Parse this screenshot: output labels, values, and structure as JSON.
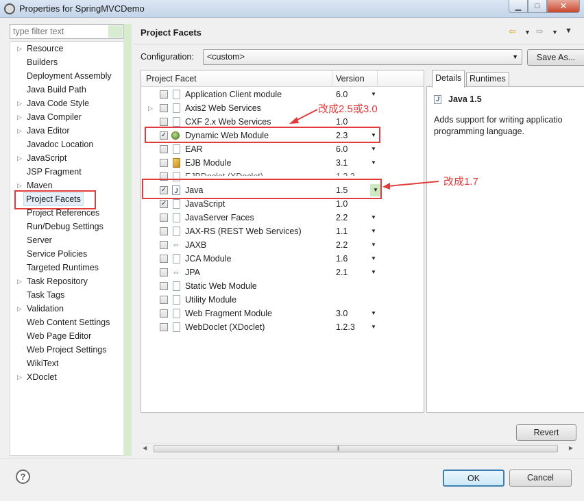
{
  "window": {
    "title": "Properties for SpringMVCDemo",
    "minimize_glyph": "▁",
    "maximize_glyph": "□",
    "close_glyph": "✕",
    "app_icon": "settings-icon"
  },
  "filter": {
    "placeholder": "type filter text",
    "value": ""
  },
  "nav": {
    "items": [
      {
        "label": "Resource",
        "expandable": true
      },
      {
        "label": "Builders",
        "expandable": false
      },
      {
        "label": "Deployment Assembly",
        "expandable": false
      },
      {
        "label": "Java Build Path",
        "expandable": false
      },
      {
        "label": "Java Code Style",
        "expandable": true
      },
      {
        "label": "Java Compiler",
        "expandable": true
      },
      {
        "label": "Java Editor",
        "expandable": true
      },
      {
        "label": "Javadoc Location",
        "expandable": false
      },
      {
        "label": "JavaScript",
        "expandable": true
      },
      {
        "label": "JSP Fragment",
        "expandable": false
      },
      {
        "label": "Maven",
        "expandable": true
      },
      {
        "label": "Project Facets",
        "expandable": false,
        "selected": true
      },
      {
        "label": "Project References",
        "expandable": false
      },
      {
        "label": "Run/Debug Settings",
        "expandable": false
      },
      {
        "label": "Server",
        "expandable": false
      },
      {
        "label": "Service Policies",
        "expandable": false
      },
      {
        "label": "Targeted Runtimes",
        "expandable": false
      },
      {
        "label": "Task Repository",
        "expandable": true
      },
      {
        "label": "Task Tags",
        "expandable": false
      },
      {
        "label": "Validation",
        "expandable": true
      },
      {
        "label": "Web Content Settings",
        "expandable": false
      },
      {
        "label": "Web Page Editor",
        "expandable": false
      },
      {
        "label": "Web Project Settings",
        "expandable": false
      },
      {
        "label": "WikiText",
        "expandable": false
      },
      {
        "label": "XDoclet",
        "expandable": true
      }
    ]
  },
  "page": {
    "title": "Project Facets"
  },
  "configuration": {
    "label": "Configuration:",
    "value": "<custom>",
    "save_as": "Save As..."
  },
  "facets": {
    "col_facet": "Project Facet",
    "col_version": "Version",
    "rows": [
      {
        "name": "Application Client module",
        "version": "6.0",
        "checked": false,
        "icon": "page-icon",
        "dropdown": true
      },
      {
        "name": "Axis2 Web Services",
        "version": "",
        "checked": false,
        "icon": "page-icon",
        "expandable": true,
        "dropdown": false
      },
      {
        "name": "CXF 2.x Web Services",
        "version": "1.0",
        "checked": false,
        "icon": "page-icon",
        "dropdown": false
      },
      {
        "name": "Dynamic Web Module",
        "version": "2.3",
        "checked": true,
        "icon": "globe-icon",
        "dropdown": true
      },
      {
        "name": "EAR",
        "version": "6.0",
        "checked": false,
        "icon": "page-icon",
        "dropdown": true
      },
      {
        "name": "EJB Module",
        "version": "3.1",
        "checked": false,
        "icon": "bean-icon",
        "dropdown": true
      },
      {
        "name": "EJBDoclet (XDoclet)",
        "version": "1.2.3",
        "checked": false,
        "icon": "page-icon",
        "dropdown": true,
        "obscured": true
      },
      {
        "name": "Java",
        "version": "1.5",
        "checked": true,
        "icon": "java-icon",
        "dropdown": true,
        "highlight_dropdown": true
      },
      {
        "name": "JavaScript",
        "version": "1.0",
        "checked": true,
        "icon": "page-icon",
        "dropdown": false
      },
      {
        "name": "JavaServer Faces",
        "version": "2.2",
        "checked": false,
        "icon": "page-icon",
        "dropdown": true
      },
      {
        "name": "JAX-RS (REST Web Services)",
        "version": "1.1",
        "checked": false,
        "icon": "page-icon",
        "dropdown": true
      },
      {
        "name": "JAXB",
        "version": "2.2",
        "checked": false,
        "icon": "arrows-icon",
        "dropdown": true
      },
      {
        "name": "JCA Module",
        "version": "1.6",
        "checked": false,
        "icon": "page-icon",
        "dropdown": true
      },
      {
        "name": "JPA",
        "version": "2.1",
        "checked": false,
        "icon": "arrows-icon",
        "dropdown": true
      },
      {
        "name": "Static Web Module",
        "version": "",
        "checked": false,
        "icon": "page-icon",
        "dropdown": false
      },
      {
        "name": "Utility Module",
        "version": "",
        "checked": false,
        "icon": "page-icon",
        "dropdown": false
      },
      {
        "name": "Web Fragment Module",
        "version": "3.0",
        "checked": false,
        "icon": "page-icon",
        "dropdown": true
      },
      {
        "name": "WebDoclet (XDoclet)",
        "version": "1.2.3",
        "checked": false,
        "icon": "page-icon",
        "dropdown": true
      }
    ]
  },
  "details": {
    "tab_details": "Details",
    "tab_runtimes": "Runtimes",
    "title": "Java 1.5",
    "description_line1": "Adds support for writing applicatio",
    "description_line2": "programming language."
  },
  "buttons": {
    "revert": "Revert",
    "ok": "OK",
    "cancel": "Cancel",
    "help": "?"
  },
  "annotations": {
    "note_web_module": "改成2.5或3.0",
    "note_java": "改成1.7",
    "color": "#e23b3b"
  }
}
